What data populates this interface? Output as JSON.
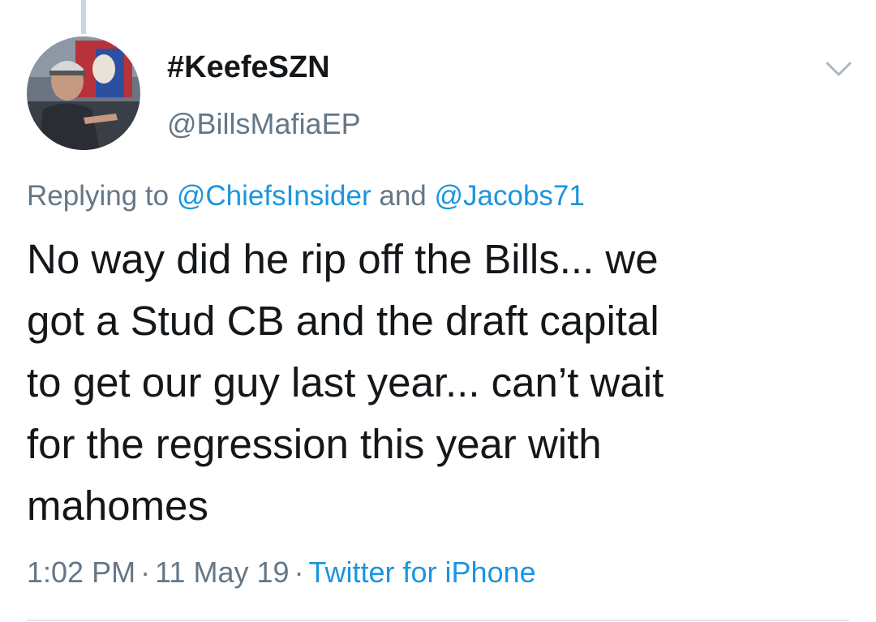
{
  "tweet": {
    "display_name": "#KeefeSZN",
    "handle": "@BillsMafiaEP",
    "replying_prefix": "Replying to ",
    "replying_to_1": "@ChiefsInsider",
    "replying_and": " and ",
    "replying_to_2": "@Jacobs71",
    "text": "No way did he rip off the Bills... we\ngot a Stud CB and the draft capital\nto get our guy last year... can’t wait\nfor the regression this year with\nmahomes",
    "time": "1:02 PM",
    "separator": "·",
    "date": "11 May 19",
    "source": "Twitter for iPhone"
  },
  "icons": {
    "caret": "chevron-down-icon",
    "avatar": "avatar-photo"
  },
  "colors": {
    "link": "#1b95e0",
    "secondary_text": "#657786",
    "primary_text": "#14171a",
    "thread_line": "#ccd6dd"
  }
}
